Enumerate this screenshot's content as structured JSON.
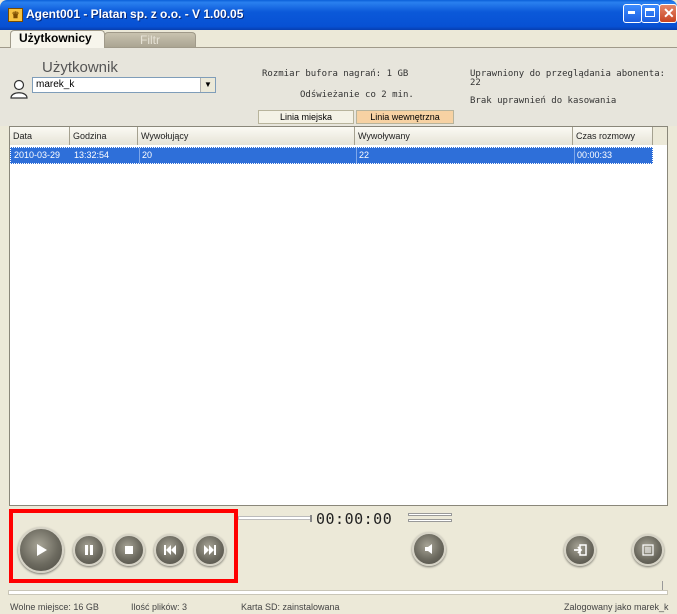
{
  "window": {
    "title": "Agent001 - Platan sp. z o.o. - V 1.00.05",
    "icon": "crown-icon"
  },
  "tabs": [
    {
      "label": "Użytkownicy",
      "active": true
    },
    {
      "label": "Filtr",
      "active": false
    }
  ],
  "user_panel": {
    "label": "Użytkownik",
    "selected_user": "marek_k"
  },
  "info": {
    "buffer": "Rozmiar bufora nagrań: 1 GB",
    "refresh": "Odświeżanie co 2 min.",
    "permission_title": "Uprawniony do przeglądania abonenta:",
    "permission_value": "22",
    "no_delete": "Brak uprawnień do kasowania"
  },
  "line_buttons": {
    "city": "Linia miejska",
    "internal": "Linia wewnętrzna"
  },
  "table": {
    "columns": [
      "Data",
      "Godzina",
      "Wywołujący",
      "Wywoływany",
      "Czas rozmowy"
    ],
    "rows": [
      {
        "date": "2010-03-29",
        "time": "13:32:54",
        "caller": "20",
        "callee": "22",
        "duration": "00:00:33"
      }
    ]
  },
  "player": {
    "time": "00:00:00",
    "buttons": [
      "play-icon",
      "pause-icon",
      "stop-icon",
      "previous-icon",
      "next-icon",
      "mute-icon",
      "export-icon",
      "menu-icon"
    ]
  },
  "status_bar": {
    "free_space": "Wolne miejsce: 16 GB",
    "file_count": "Ilość plików: 3",
    "sd_card": "Karta SD: zainstalowana",
    "logged_in": "Zalogowany jako marek_k"
  },
  "colors": {
    "titlebar": "#0b59d9",
    "selection": "#2e6fd9",
    "internal_line": "#f7d2a3",
    "highlight": "#ff0000"
  }
}
